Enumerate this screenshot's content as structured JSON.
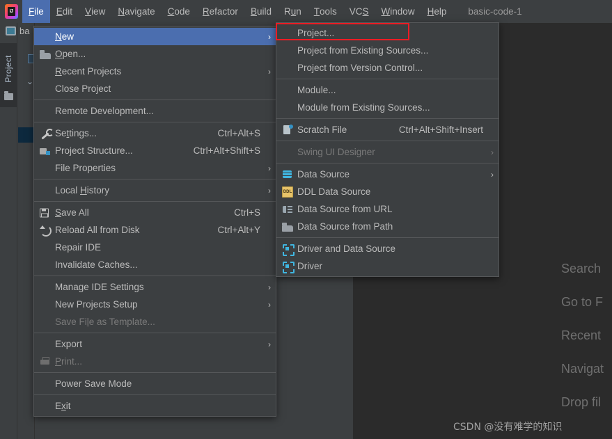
{
  "window": {
    "app_logo": "intellij-idea-logo",
    "project_name": "basic-code-1",
    "tab_label": "ba"
  },
  "menubar": {
    "items": [
      {
        "label": "File",
        "mnemonic": "F",
        "active": true
      },
      {
        "label": "Edit",
        "mnemonic": "E",
        "active": false
      },
      {
        "label": "View",
        "mnemonic": "V",
        "active": false
      },
      {
        "label": "Navigate",
        "mnemonic": "N",
        "active": false
      },
      {
        "label": "Code",
        "mnemonic": "C",
        "active": false
      },
      {
        "label": "Refactor",
        "mnemonic": "R",
        "active": false
      },
      {
        "label": "Build",
        "mnemonic": "B",
        "active": false
      },
      {
        "label": "Run",
        "mnemonic": "u",
        "active": false
      },
      {
        "label": "Tools",
        "mnemonic": "T",
        "active": false
      },
      {
        "label": "VCS",
        "mnemonic": "S",
        "active": false
      },
      {
        "label": "Window",
        "mnemonic": "W",
        "active": false
      },
      {
        "label": "Help",
        "mnemonic": "H",
        "active": false
      }
    ]
  },
  "sidebar": {
    "project_tab_label": "Project",
    "folder_icon": "folder-icon"
  },
  "file_menu": {
    "rows": [
      {
        "type": "item",
        "label": "New",
        "icon": null,
        "accel": "",
        "arrow": true,
        "selected": true,
        "disabled": false,
        "mnemonic": "N"
      },
      {
        "type": "item",
        "label": "Open...",
        "icon": "folder-open-icon",
        "accel": "",
        "arrow": false,
        "selected": false,
        "disabled": false,
        "mnemonic": "O"
      },
      {
        "type": "item",
        "label": "Recent Projects",
        "icon": null,
        "accel": "",
        "arrow": true,
        "selected": false,
        "disabled": false,
        "mnemonic": "R"
      },
      {
        "type": "item",
        "label": "Close Project",
        "icon": null,
        "accel": "",
        "arrow": false,
        "selected": false,
        "disabled": false,
        "mnemonic": ""
      },
      {
        "type": "separator"
      },
      {
        "type": "item",
        "label": "Remote Development...",
        "icon": null,
        "accel": "",
        "arrow": false,
        "selected": false,
        "disabled": false,
        "mnemonic": ""
      },
      {
        "type": "separator"
      },
      {
        "type": "item",
        "label": "Settings...",
        "icon": "wrench-icon",
        "accel": "Ctrl+Alt+S",
        "arrow": false,
        "selected": false,
        "disabled": false,
        "mnemonic": "t"
      },
      {
        "type": "item",
        "label": "Project Structure...",
        "icon": "project-structure-icon",
        "accel": "Ctrl+Alt+Shift+S",
        "arrow": false,
        "selected": false,
        "disabled": false,
        "mnemonic": ""
      },
      {
        "type": "item",
        "label": "File Properties",
        "icon": null,
        "accel": "",
        "arrow": true,
        "selected": false,
        "disabled": false,
        "mnemonic": ""
      },
      {
        "type": "separator"
      },
      {
        "type": "item",
        "label": "Local History",
        "icon": null,
        "accel": "",
        "arrow": true,
        "selected": false,
        "disabled": false,
        "mnemonic": "H"
      },
      {
        "type": "separator"
      },
      {
        "type": "item",
        "label": "Save All",
        "icon": "save-icon",
        "accel": "Ctrl+S",
        "arrow": false,
        "selected": false,
        "disabled": false,
        "mnemonic": "S"
      },
      {
        "type": "item",
        "label": "Reload All from Disk",
        "icon": "reload-icon",
        "accel": "Ctrl+Alt+Y",
        "arrow": false,
        "selected": false,
        "disabled": false,
        "mnemonic": ""
      },
      {
        "type": "item",
        "label": "Repair IDE",
        "icon": null,
        "accel": "",
        "arrow": false,
        "selected": false,
        "disabled": false,
        "mnemonic": ""
      },
      {
        "type": "item",
        "label": "Invalidate Caches...",
        "icon": null,
        "accel": "",
        "arrow": false,
        "selected": false,
        "disabled": false,
        "mnemonic": ""
      },
      {
        "type": "separator"
      },
      {
        "type": "item",
        "label": "Manage IDE Settings",
        "icon": null,
        "accel": "",
        "arrow": true,
        "selected": false,
        "disabled": false,
        "mnemonic": ""
      },
      {
        "type": "item",
        "label": "New Projects Setup",
        "icon": null,
        "accel": "",
        "arrow": true,
        "selected": false,
        "disabled": false,
        "mnemonic": ""
      },
      {
        "type": "item",
        "label": "Save File as Template...",
        "icon": null,
        "accel": "",
        "arrow": false,
        "selected": false,
        "disabled": true,
        "mnemonic": "l"
      },
      {
        "type": "separator"
      },
      {
        "type": "item",
        "label": "Export",
        "icon": null,
        "accel": "",
        "arrow": true,
        "selected": false,
        "disabled": false,
        "mnemonic": ""
      },
      {
        "type": "item",
        "label": "Print...",
        "icon": "print-icon",
        "accel": "",
        "arrow": false,
        "selected": false,
        "disabled": true,
        "mnemonic": "P"
      },
      {
        "type": "separator"
      },
      {
        "type": "item",
        "label": "Power Save Mode",
        "icon": null,
        "accel": "",
        "arrow": false,
        "selected": false,
        "disabled": false,
        "mnemonic": ""
      },
      {
        "type": "separator"
      },
      {
        "type": "item",
        "label": "Exit",
        "icon": null,
        "accel": "",
        "arrow": false,
        "selected": false,
        "disabled": false,
        "mnemonic": "x"
      }
    ]
  },
  "new_submenu": {
    "rows": [
      {
        "type": "item",
        "label": "Project...",
        "icon": null,
        "accel": "",
        "arrow": false,
        "selected": false,
        "disabled": false,
        "highlighted": true
      },
      {
        "type": "item",
        "label": "Project from Existing Sources...",
        "icon": null,
        "accel": "",
        "arrow": false,
        "selected": false,
        "disabled": false
      },
      {
        "type": "item",
        "label": "Project from Version Control...",
        "icon": null,
        "accel": "",
        "arrow": false,
        "selected": false,
        "disabled": false
      },
      {
        "type": "separator"
      },
      {
        "type": "item",
        "label": "Module...",
        "icon": null,
        "accel": "",
        "arrow": false,
        "selected": false,
        "disabled": false
      },
      {
        "type": "item",
        "label": "Module from Existing Sources...",
        "icon": null,
        "accel": "",
        "arrow": false,
        "selected": false,
        "disabled": false
      },
      {
        "type": "separator"
      },
      {
        "type": "item",
        "label": "Scratch File",
        "icon": "scratch-file-icon",
        "accel": "Ctrl+Alt+Shift+Insert",
        "arrow": false,
        "selected": false,
        "disabled": false
      },
      {
        "type": "separator"
      },
      {
        "type": "item",
        "label": "Swing UI Designer",
        "icon": null,
        "accel": "",
        "arrow": true,
        "selected": false,
        "disabled": true
      },
      {
        "type": "separator"
      },
      {
        "type": "item",
        "label": "Data Source",
        "icon": "database-icon",
        "accel": "",
        "arrow": true,
        "selected": false,
        "disabled": false
      },
      {
        "type": "item",
        "label": "DDL Data Source",
        "icon": "ddl-icon",
        "accel": "",
        "arrow": false,
        "selected": false,
        "disabled": false
      },
      {
        "type": "item",
        "label": "Data Source from URL",
        "icon": "url-icon",
        "accel": "",
        "arrow": false,
        "selected": false,
        "disabled": false
      },
      {
        "type": "item",
        "label": "Data Source from Path",
        "icon": "folder-open-icon",
        "accel": "",
        "arrow": false,
        "selected": false,
        "disabled": false
      },
      {
        "type": "separator"
      },
      {
        "type": "item",
        "label": "Driver and Data Source",
        "icon": "driver-icon",
        "accel": "",
        "arrow": false,
        "selected": false,
        "disabled": false
      },
      {
        "type": "item",
        "label": "Driver",
        "icon": "driver-icon",
        "accel": "",
        "arrow": false,
        "selected": false,
        "disabled": false
      }
    ]
  },
  "editor_hints": {
    "lines": [
      "Search",
      "Go to F",
      "Recent",
      "Navigat",
      "Drop fil"
    ]
  },
  "annotation": {
    "highlight_color": "#ec1c24",
    "target": "Project..."
  },
  "watermark": {
    "text": "CSDN @没有难学的知识"
  },
  "colors": {
    "menu_bg": "#3c3f41",
    "editor_bg": "#2b2b2b",
    "selection_blue": "#4b6eaf",
    "text": "#bbbbbb",
    "disabled_text": "#7a7a7a",
    "separator": "#555759",
    "accent_red": "#ec1c24"
  }
}
